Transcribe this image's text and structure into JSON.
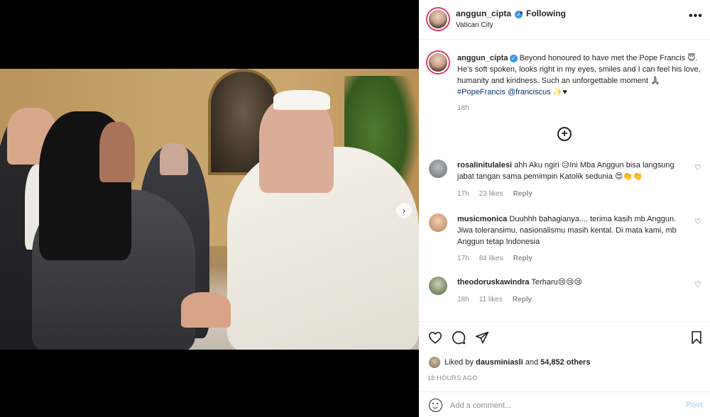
{
  "post": {
    "username": "anggun_cipta",
    "separator": "•",
    "follow_status": "Following",
    "location": "Vatican City",
    "more_label": "•••",
    "verified_glyph": "✓"
  },
  "caption": {
    "username": "anggun_cipta",
    "text": " Beyond honoured to have met the Pope Francis 😇. He's soft spoken, looks right in my eyes, smiles and I can feel his love, humanity and kindness. Such an unforgettable moment 🙏🏽 ",
    "hashtag": "#PopeFrancis",
    "mention": "@franciscus",
    "trailing": " ✨♥",
    "time": "18h"
  },
  "load_more_label": "+",
  "comments": [
    {
      "username": "rosalinitulalesi",
      "text": " ahh Aku ngiri 😥Ini Mba Anggun bisa langsung jabat tangan sama pemimpin Katolik sedunia 😍👏👏",
      "time": "17h",
      "likes": "23 likes",
      "reply": "Reply",
      "avatar_color": "#8a8f93"
    },
    {
      "username": "musicmonica",
      "text": " Duuhhh bahagianya.... terima kasih mb Anggun. Jiwa toleransimu, nasionalismu masih kental. Di mata kami, mb Anggun tetap Indonesia",
      "time": "17h",
      "likes": "84 likes",
      "reply": "Reply",
      "avatar_color": "#c9a37e"
    },
    {
      "username": "theodoruskawindra",
      "text": " Terharu😢😢😢",
      "time": "18h",
      "likes": "11 likes",
      "reply": "Reply",
      "avatar_color": "#6f7a62"
    }
  ],
  "icons": {
    "like": "heart-icon",
    "comment": "comment-icon",
    "share": "share-icon",
    "save": "bookmark-icon",
    "emoji": "smile-icon",
    "comment_like": "♡",
    "carousel_next": "›"
  },
  "likes": {
    "prefix": "Liked by ",
    "user": "dausminiasli",
    "middle": " and ",
    "count": "54,852 others"
  },
  "posted_ago": "18 HOURS AGO",
  "add_comment": {
    "placeholder": "Add a comment...",
    "post_label": "Post"
  },
  "colors": {
    "accent": "#3897f0",
    "link": "#00376b",
    "muted": "#8e8e8e",
    "post_disabled": "#b3dbff"
  },
  "carousel": {
    "slides": 3,
    "active": 0
  }
}
